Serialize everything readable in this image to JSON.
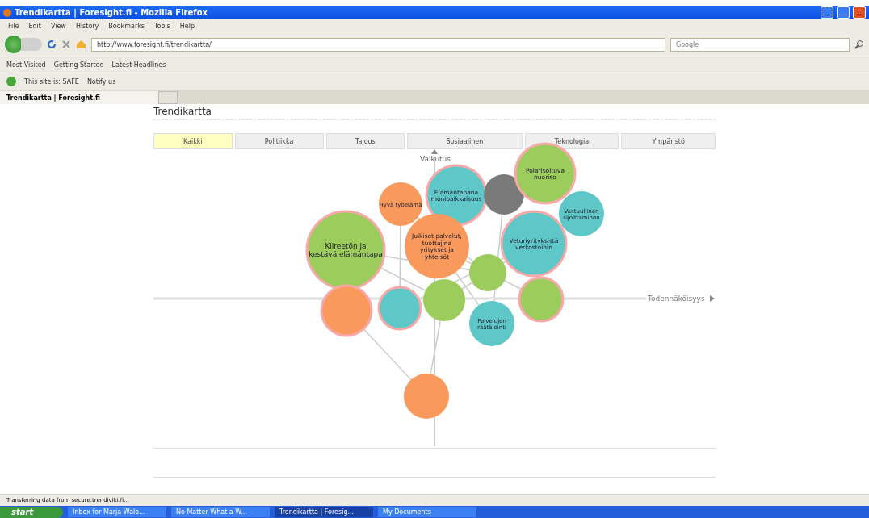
{
  "window": {
    "title": "Trendikartta | Foresight.fi - Mozilla Firefox"
  },
  "menu": [
    "File",
    "Edit",
    "View",
    "History",
    "Bookmarks",
    "Tools",
    "Help"
  ],
  "address": {
    "value": "http://www.foresight.fi/trendikartta/"
  },
  "search": {
    "placeholder": "Google"
  },
  "bookmarks": [
    "Most Visited",
    "Getting Started",
    "Latest Headlines"
  ],
  "addon_bar": {
    "safe": "This site is: SAFE",
    "notify": "Notify us"
  },
  "browser_tabs": [
    {
      "label": "Trendikartta | Foresight.fi",
      "selected": true
    }
  ],
  "page": {
    "title": "Trendikartta",
    "filters": [
      {
        "label": "Kaikki",
        "selected": true
      },
      {
        "label": "Politiikka",
        "selected": false
      },
      {
        "label": "Talous",
        "selected": false
      },
      {
        "label": "Sosiaalinen",
        "selected": false
      },
      {
        "label": "Teknologia",
        "selected": false
      },
      {
        "label": "Ympäristö",
        "selected": false
      }
    ],
    "y_axis": "Vaikutus",
    "x_axis": "Todennäköisyys",
    "bubbles": [
      {
        "label_lines": [
          "Kiireetön ja",
          "kestävä elämäntapa"
        ],
        "color": "#9ccc5c",
        "highlighted": true
      },
      {
        "label_lines": [
          "Hyvä työelämä"
        ],
        "color": "#f99a5c",
        "highlighted": false
      },
      {
        "label_lines": [
          "Elämäntapana",
          "monipaikkaisuus"
        ],
        "color": "#5ec8c8",
        "highlighted": true
      },
      {
        "color": "#7a7a7a",
        "highlighted": false
      },
      {
        "label_lines": [
          "Polarisoituva",
          "nuoriso"
        ],
        "color": "#9ccc5c",
        "highlighted": true
      },
      {
        "label_lines": [
          "Vastuullinen",
          "sijoittaminen"
        ],
        "color": "#5ec8c8",
        "highlighted": false
      },
      {
        "label_lines": [
          "Julkiset palvelut,",
          "tuottajina",
          "yritykset ja",
          "yhteisöt"
        ],
        "color": "#f99a5c",
        "highlighted": false
      },
      {
        "label_lines": [
          "Veturiyrityksistä",
          "verkostoihin"
        ],
        "color": "#5ec8c8",
        "highlighted": true
      },
      {
        "color": "#9ccc5c",
        "highlighted": false
      },
      {
        "label_lines": [
          "Palvelujen",
          "räätälointi"
        ],
        "color": "#5ec8c8",
        "highlighted": false
      },
      {
        "color": "#9ccc5c",
        "highlighted": true
      },
      {
        "color": "#f99a5c",
        "highlighted": true
      },
      {
        "color": "#5ec8c8",
        "highlighted": true
      },
      {
        "color": "#9ccc5c",
        "highlighted": false
      },
      {
        "color": "#f99a5c",
        "highlighted": false
      }
    ]
  },
  "status_bar": "Transferring data from secure.trendiviki.fi...",
  "taskbar": {
    "start": "start",
    "items": [
      {
        "label": "Inbox for Marja Walo...",
        "selected": false
      },
      {
        "label": "No Matter What a W...",
        "selected": false
      },
      {
        "label": "Trendikartta | Foresig...",
        "selected": true
      },
      {
        "label": "My Documents",
        "selected": false
      }
    ]
  }
}
